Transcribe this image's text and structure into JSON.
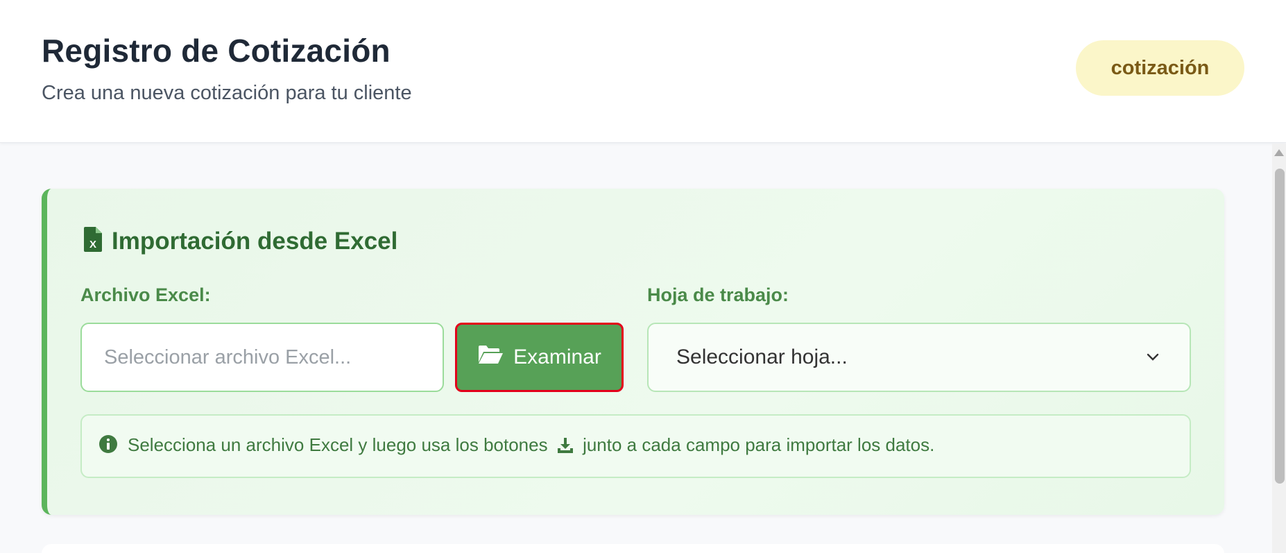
{
  "header": {
    "title": "Registro de Cotización",
    "subtitle": "Crea una nueva cotización para tu cliente",
    "badge": "cotización"
  },
  "import_card": {
    "title": "Importación desde Excel",
    "title_icon": "file-excel-icon",
    "file_label": "Archivo Excel:",
    "file_placeholder": "Seleccionar archivo Excel...",
    "file_value": "",
    "browse_button": "Examinar",
    "browse_icon": "folder-open-icon",
    "sheet_label": "Hoja de trabajo:",
    "sheet_selected": "Seleccionar hoja...",
    "info_icon": "info-circle-icon",
    "info_text_before": "Selecciona un archivo Excel y luego usa los botones",
    "info_inline_icon": "download-icon",
    "info_text_after": "junto a cada campo para importar los datos."
  },
  "colors": {
    "accent_green": "#57a157",
    "title_green": "#2f6b33",
    "badge_bg": "#fbf6c9",
    "badge_text": "#7a5a16",
    "highlight_red": "#e3001b"
  }
}
